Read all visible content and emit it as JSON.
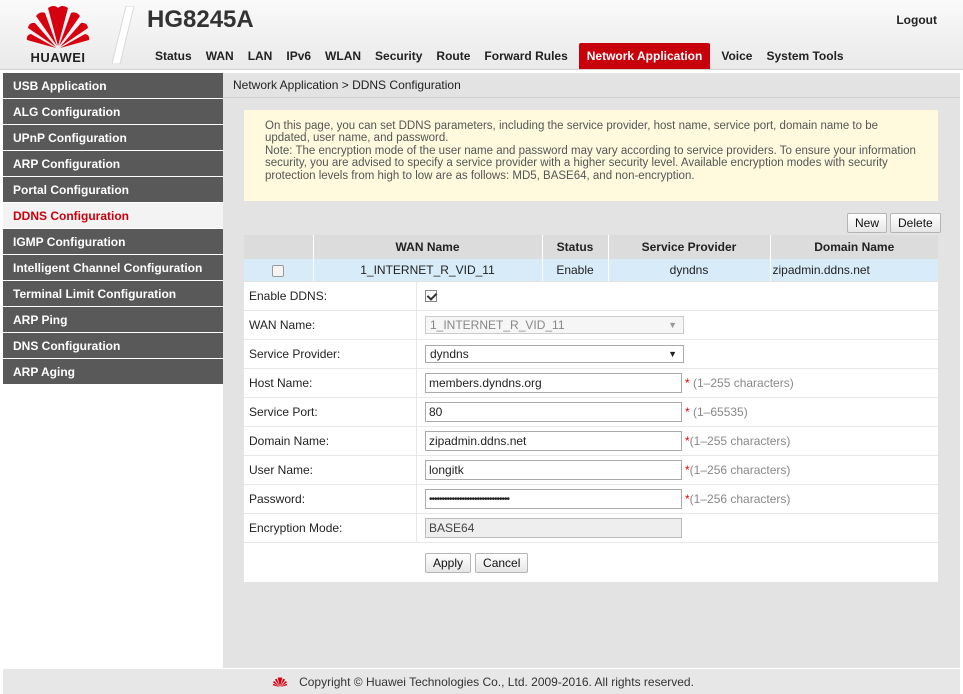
{
  "brand": {
    "logo_text": "HUAWEI",
    "model": "HG8245A",
    "accent": "#c7000b"
  },
  "header": {
    "logout": "Logout"
  },
  "nav": [
    "Status",
    "WAN",
    "LAN",
    "IPv6",
    "WLAN",
    "Security",
    "Route",
    "Forward Rules",
    "Network Application",
    "Voice",
    "System Tools"
  ],
  "nav_active": "Network Application",
  "sidebar": {
    "items": [
      {
        "label": "USB Application"
      },
      {
        "label": "ALG Configuration"
      },
      {
        "label": "UPnP Configuration"
      },
      {
        "label": "ARP Configuration"
      },
      {
        "label": "Portal Configuration"
      },
      {
        "label": "DDNS Configuration"
      },
      {
        "label": "IGMP Configuration"
      },
      {
        "label": "Intelligent Channel Configuration"
      },
      {
        "label": "Terminal Limit Configuration"
      },
      {
        "label": "ARP Ping"
      },
      {
        "label": "DNS Configuration"
      },
      {
        "label": "ARP Aging"
      }
    ],
    "active": "DDNS Configuration"
  },
  "breadcrumb": "Network Application > DDNS Configuration",
  "notice": {
    "line1": "On this page, you can set DDNS parameters, including the service provider, host name, service port, domain name to be updated, user name, and password.",
    "line2": "Note: The encryption mode of the user name and password may vary according to service providers. To ensure your information security, you are advised to specify a service provider with a higher security level. Available encryption modes with security protection levels from high to low are as follows: MD5, BASE64, and non-encryption."
  },
  "buttons": {
    "new": "New",
    "delete": "Delete",
    "apply": "Apply",
    "cancel": "Cancel"
  },
  "table": {
    "headers": [
      "",
      "WAN Name",
      "Status",
      "Service Provider",
      "Domain Name"
    ],
    "rows": [
      {
        "wan_name": "1_INTERNET_R_VID_11",
        "status": "Enable",
        "provider": "dyndns",
        "domain": "zipadmin.ddns.net"
      }
    ]
  },
  "form": {
    "enable_ddns": {
      "label": "Enable DDNS:",
      "checked": true
    },
    "wan_name": {
      "label": "WAN Name:",
      "value": "1_INTERNET_R_VID_11"
    },
    "service_provider": {
      "label": "Service Provider:",
      "value": "dyndns"
    },
    "host_name": {
      "label": "Host Name:",
      "value": "members.dyndns.org",
      "hint_star": "*",
      "hint": " (1–255 characters)"
    },
    "service_port": {
      "label": "Service Port:",
      "value": "80",
      "hint_star": "*",
      "hint": " (1–65535)"
    },
    "domain_name": {
      "label": "Domain Name:",
      "value": "zipadmin.ddns.net",
      "hint_star": "*",
      "hint": "(1–255 characters)"
    },
    "user_name": {
      "label": "User Name:",
      "value": "longitk",
      "hint_star": "*",
      "hint": "(1–256 characters)"
    },
    "password": {
      "label": "Password:",
      "value": "••••••••••••••••••••••••••••••••",
      "hint_star": "*",
      "hint": "(1–256 characters)"
    },
    "encryption_mode": {
      "label": "Encryption Mode:",
      "value": "BASE64"
    }
  },
  "footer": {
    "copyright": "Copyright © Huawei Technologies Co., Ltd. 2009-2016. All rights reserved."
  }
}
